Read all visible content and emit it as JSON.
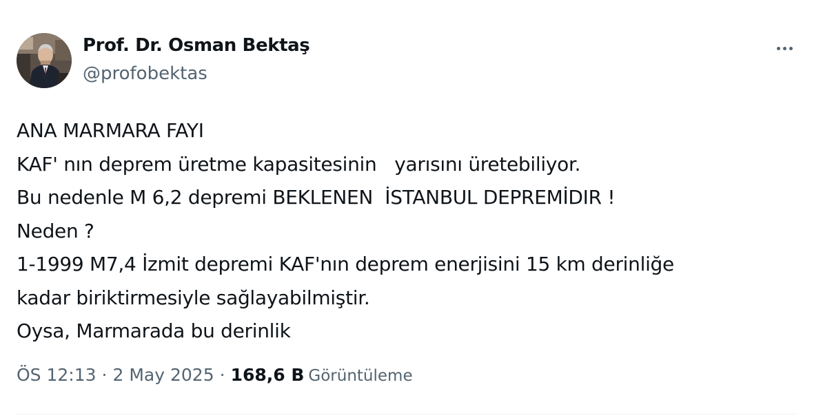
{
  "author": {
    "name": "Prof. Dr. Osman Bektaş",
    "handle": "@profobektas",
    "avatar_icon": "profile-photo"
  },
  "more_icon": "more-dots-icon",
  "tweet": {
    "lines": [
      "ANA MARMARA FAYI",
      "KAF' nın deprem üretme kapasitesinin   yarısını üretebiliyor.",
      "Bu nedenle M 6,2 depremi BEKLENEN  İSTANBUL DEPREMİDIR !",
      "Neden ?",
      "1-1999 M7,4 İzmit depremi KAF'nın deprem enerjisini 15 km derinliğe",
      "kadar biriktirmesiyle sağlayabilmiştir.",
      "Oysa, Marmarada bu derinlik"
    ]
  },
  "meta": {
    "time": "ÖS 12:13",
    "separator": "·",
    "date": "2 May 2025",
    "views_count": "168,6 B",
    "views_label": "Görüntüleme"
  },
  "colors": {
    "primary_text": "#0f1419",
    "secondary_text": "#536471",
    "divider": "#eff3f4"
  }
}
